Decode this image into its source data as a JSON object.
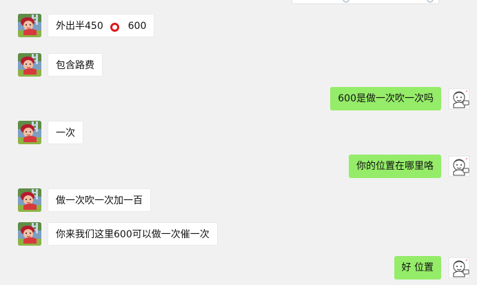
{
  "messages": [
    {
      "side": "in",
      "text_before": "外出半450",
      "icon": "red-circle-icon",
      "text_after": "600"
    },
    {
      "side": "in",
      "text": "包含路费"
    },
    {
      "side": "out",
      "text": "600是做一次吹一次吗"
    },
    {
      "side": "in",
      "text": "一次"
    },
    {
      "side": "out",
      "text": "你的位置在哪里咯"
    },
    {
      "side": "in",
      "text": "做一次吹一次加一百"
    },
    {
      "side": "in",
      "text": "你来我们这里600可以做一次催一次"
    },
    {
      "side": "out",
      "text": "好 位置"
    }
  ],
  "colors": {
    "background": "#f1f1f1",
    "incoming_bubble": "#ffffff",
    "outgoing_bubble": "#95ec69",
    "text": "#111111",
    "emoji_ring": "#d9181b"
  }
}
